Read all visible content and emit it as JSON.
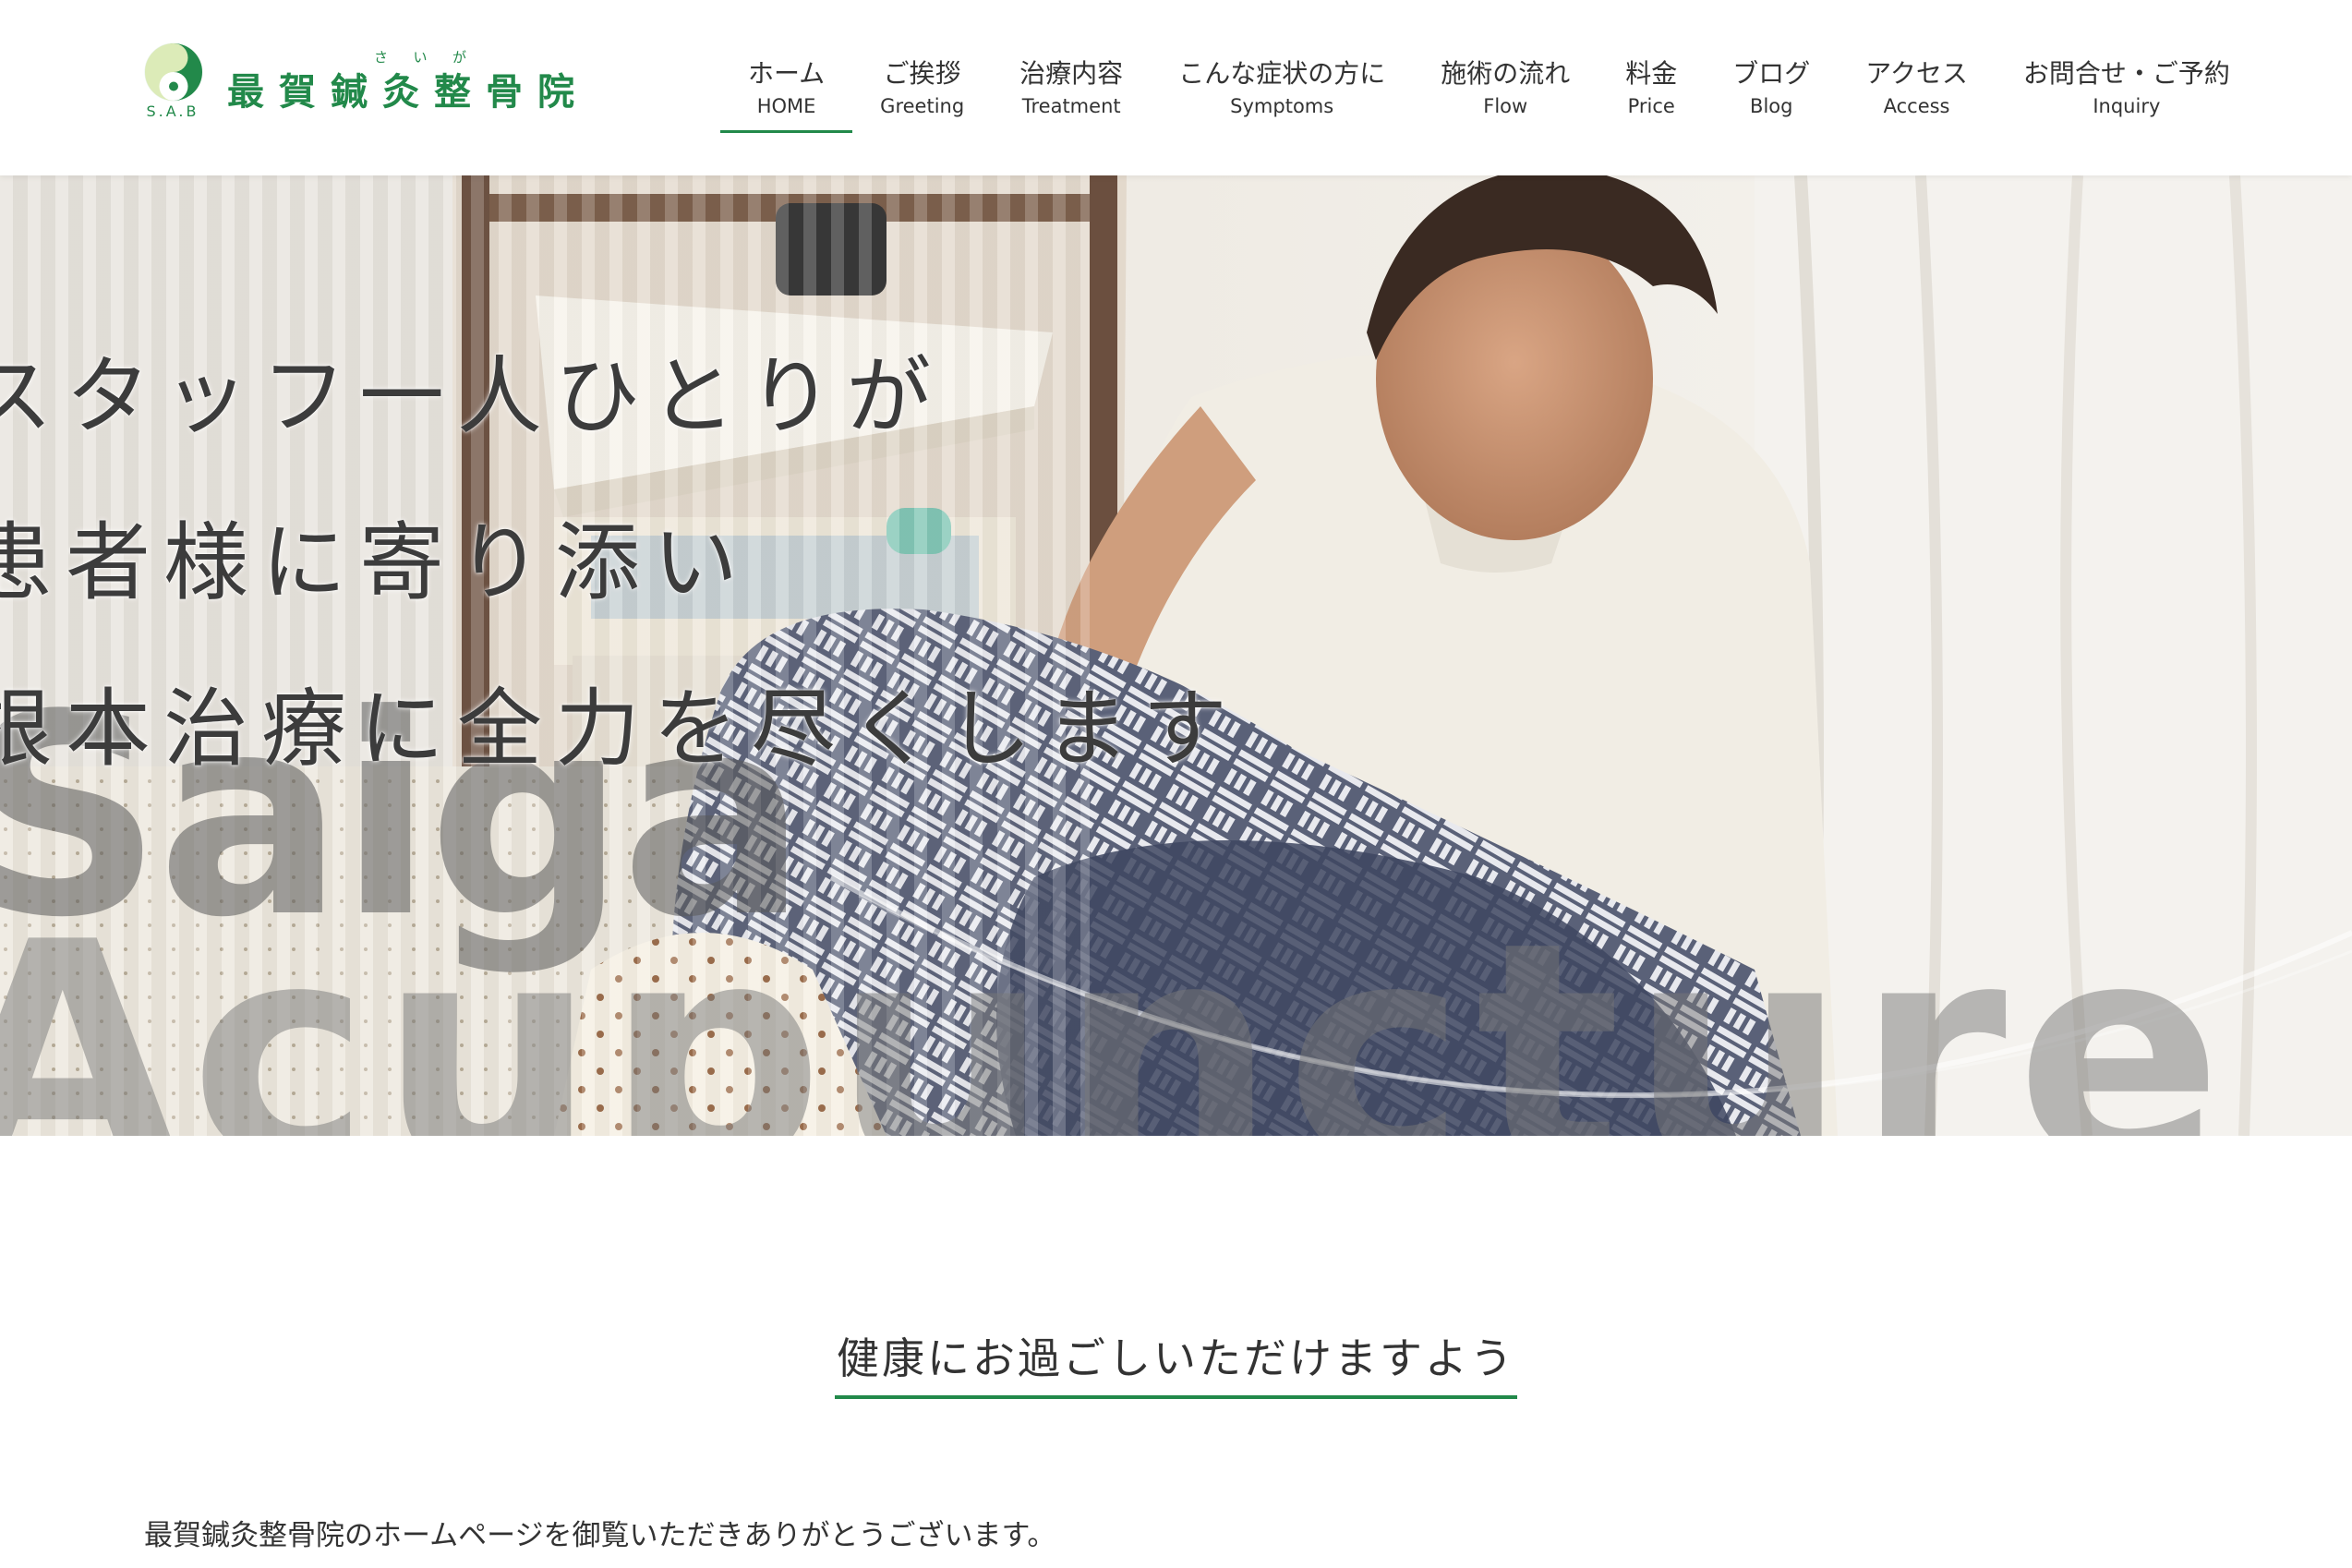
{
  "brand": {
    "ruby": [
      "さ",
      "い",
      "が"
    ],
    "name": "最賀鍼灸整骨院",
    "abbr": "S.A.B",
    "color": "#22894a"
  },
  "nav": [
    {
      "ja": "ホーム",
      "en": "HOME",
      "active": true
    },
    {
      "ja": "ご挨拶",
      "en": "Greeting"
    },
    {
      "ja": "治療内容",
      "en": "Treatment"
    },
    {
      "ja": "こんな症状の方に",
      "en": "Symptoms"
    },
    {
      "ja": "施術の流れ",
      "en": "Flow"
    },
    {
      "ja": "料金",
      "en": "Price"
    },
    {
      "ja": "ブログ",
      "en": "Blog"
    },
    {
      "ja": "アクセス",
      "en": "Access"
    },
    {
      "ja": "お問合せ・ご予約",
      "en": "Inquiry"
    }
  ],
  "hero": {
    "lines": [
      "スタッフ一人ひとりが",
      "患者様に寄り添い",
      "根本治療に全力を尽くします"
    ],
    "bg_text_1": "Saiga",
    "bg_text_2": "Acupuncture"
  },
  "greeting": {
    "title": "健康にお過ごしいただけますよう",
    "text": "最賀鍼灸整骨院のホームページを御覧いただきありがとうございます。"
  }
}
